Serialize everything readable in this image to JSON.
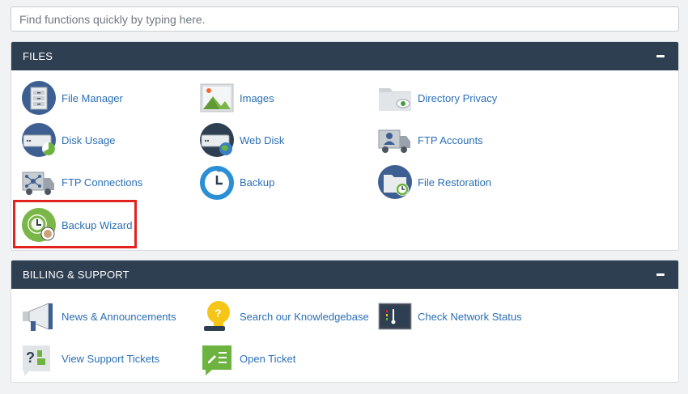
{
  "search": {
    "placeholder": "Find functions quickly by typing here."
  },
  "files": {
    "title": "FILES",
    "items": [
      {
        "label": "File Manager",
        "icon": "file-manager-icon"
      },
      {
        "label": "Images",
        "icon": "images-icon"
      },
      {
        "label": "Directory Privacy",
        "icon": "directory-privacy-icon"
      },
      {
        "label": "Disk Usage",
        "icon": "disk-usage-icon"
      },
      {
        "label": "Web Disk",
        "icon": "web-disk-icon"
      },
      {
        "label": "FTP Accounts",
        "icon": "ftp-accounts-icon"
      },
      {
        "label": "FTP Connections",
        "icon": "ftp-connections-icon"
      },
      {
        "label": "Backup",
        "icon": "backup-icon"
      },
      {
        "label": "File Restoration",
        "icon": "file-restoration-icon"
      },
      {
        "label": "Backup Wizard",
        "icon": "backup-wizard-icon"
      }
    ]
  },
  "billing": {
    "title": "BILLING & SUPPORT",
    "items": [
      {
        "label": "News & Announcements",
        "icon": "megaphone-icon"
      },
      {
        "label": "Search our Knowledgebase",
        "icon": "lightbulb-icon"
      },
      {
        "label": "Check Network Status",
        "icon": "network-status-icon"
      },
      {
        "label": "View Support Tickets",
        "icon": "question-tickets-icon"
      },
      {
        "label": "Open Ticket",
        "icon": "open-ticket-icon"
      }
    ]
  },
  "colors": {
    "panel_header": "#2f3f52",
    "link": "#2a6fb5",
    "highlight": "#e0231f",
    "background": "#f1f2f4"
  }
}
